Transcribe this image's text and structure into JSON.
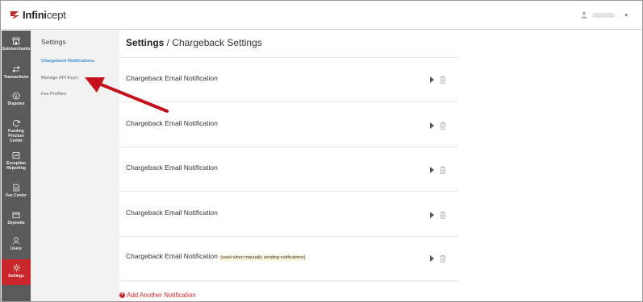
{
  "brand": {
    "name_bold": "Infini",
    "name_light": "cept",
    "accent": "#c9262c"
  },
  "topbar": {
    "user_caret": "▾"
  },
  "sidebar": {
    "items": [
      {
        "label": "Submerchants",
        "icon": "store-icon"
      },
      {
        "label": "Transactions",
        "icon": "swap-arrows-icon"
      },
      {
        "label": "Disputes",
        "icon": "dispute-coin-icon"
      },
      {
        "label": "Funding Process Center",
        "icon": "refresh-icon"
      },
      {
        "label": "Exception Reporting",
        "icon": "report-icon"
      },
      {
        "label": "Fee Center",
        "icon": "document-icon"
      },
      {
        "label": "Deposits",
        "icon": "wallet-icon"
      },
      {
        "label": "Users",
        "icon": "user-icon"
      },
      {
        "label": "Settings",
        "icon": "gear-icon",
        "active": true
      }
    ]
  },
  "subnav": {
    "title": "Settings",
    "links": [
      {
        "label": "Chargeback Notifications",
        "active": true
      },
      {
        "label": "Manage API Keys",
        "active": false
      },
      {
        "label": "Fee Profiles",
        "active": false
      }
    ]
  },
  "main": {
    "title_bold": "Settings",
    "title_rest": " / Chargeback Settings",
    "notifications": [
      {
        "label": "Chargeback Email Notification",
        "note": ""
      },
      {
        "label": "Chargeback Email Notification",
        "note": ""
      },
      {
        "label": "Chargeback Email Notification",
        "note": ""
      },
      {
        "label": "Chargeback Email Notification",
        "note": ""
      },
      {
        "label": "Chargeback Email Notification",
        "note": "(used when manually sending notifications)"
      }
    ],
    "add_label": "Add Another Notification"
  }
}
